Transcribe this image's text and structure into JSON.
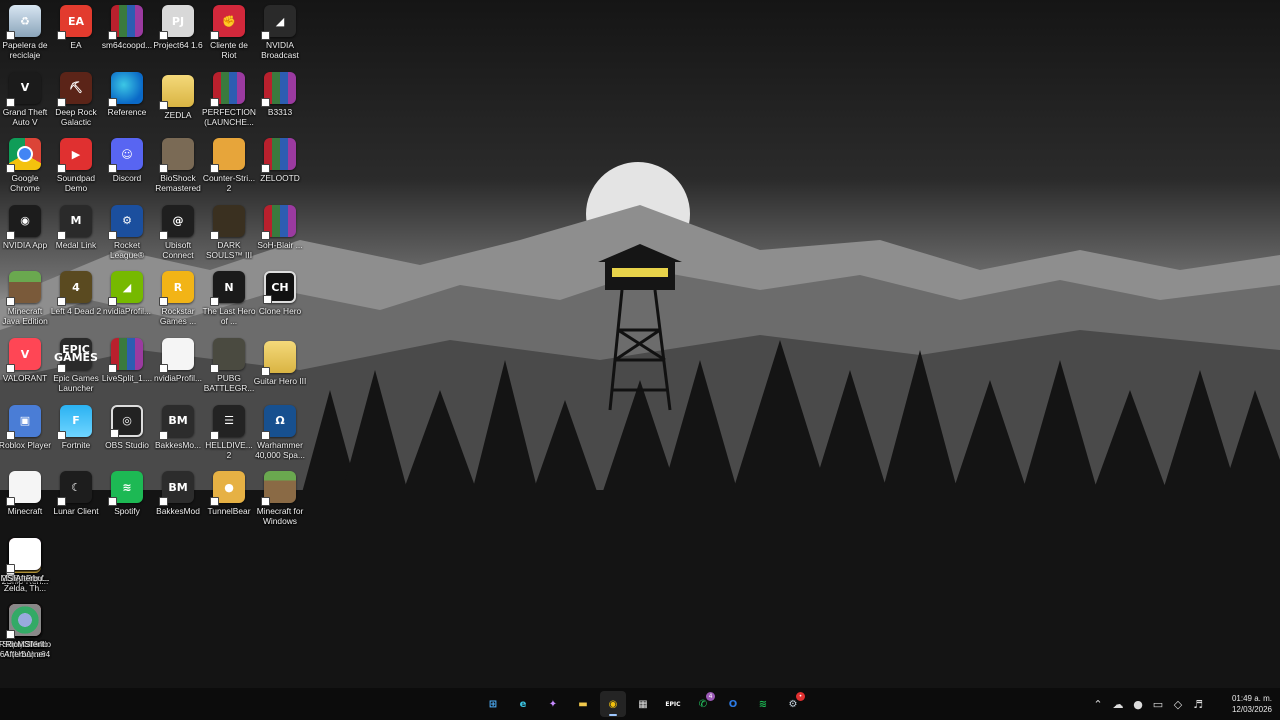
{
  "desktop": {
    "icons": [
      {
        "label": "Papelera de reciclaje",
        "icon": "recycle-bin-icon"
      },
      {
        "label": "EA",
        "icon": "ea-icon"
      },
      {
        "label": "sm64coopd...",
        "icon": "winrar-archive-icon"
      },
      {
        "label": "Project64 1.6",
        "icon": "project64-icon"
      },
      {
        "label": "Cliente de Riot",
        "icon": "riot-client-icon"
      },
      {
        "label": "NVIDIA Broadcast",
        "icon": "nvidia-broadcast-icon"
      },
      {
        "label": "Grand Theft Auto V",
        "icon": "gta-v-icon"
      },
      {
        "label": "Deep Rock Galactic",
        "icon": "deep-rock-galactic-icon"
      },
      {
        "label": "Reference",
        "icon": "edge-icon"
      },
      {
        "label": "ZEDLA",
        "icon": "folder-icon"
      },
      {
        "label": "PERFECTION (LAUNCHE...",
        "icon": "winrar-archive-icon"
      },
      {
        "label": "B3313",
        "icon": "winrar-archive-icon"
      },
      {
        "label": "Google Chrome",
        "icon": "chrome-icon"
      },
      {
        "label": "Soundpad Demo",
        "icon": "soundpad-icon"
      },
      {
        "label": "Discord",
        "icon": "discord-icon"
      },
      {
        "label": "BioShock Remastered",
        "icon": "bioshock-icon"
      },
      {
        "label": "Counter-Stri... 2",
        "icon": "counter-strike-icon"
      },
      {
        "label": "ZELOOTD",
        "icon": "winrar-archive-icon"
      },
      {
        "label": "NVIDIA App",
        "icon": "nvidia-app-icon"
      },
      {
        "label": "Medal Link",
        "icon": "medal-link-icon"
      },
      {
        "label": "Rocket League®",
        "icon": "rocket-league-icon"
      },
      {
        "label": "Ubisoft Connect",
        "icon": "ubisoft-connect-icon"
      },
      {
        "label": "DARK SOULS™ III",
        "icon": "dark-souls-icon"
      },
      {
        "label": "SoH-Blair ...",
        "icon": "winrar-archive-icon"
      },
      {
        "label": "Minecraft Java Edition",
        "icon": "minecraft-icon"
      },
      {
        "label": "Left 4 Dead 2",
        "icon": "left4dead-icon"
      },
      {
        "label": "nvidiaProfil...",
        "icon": "nvidia-profile-icon"
      },
      {
        "label": "Rockstar Games ...",
        "icon": "rockstar-icon"
      },
      {
        "label": "The Last Hero of ...",
        "icon": "last-hero-icon"
      },
      {
        "label": "Clone Hero",
        "icon": "clone-hero-icon"
      },
      {
        "label": "VALORANT",
        "icon": "valorant-icon"
      },
      {
        "label": "Epic Games Launcher",
        "icon": "epic-games-icon"
      },
      {
        "label": "LiveSplit_1....",
        "icon": "winrar-archive-icon"
      },
      {
        "label": "nvidiaProfil...",
        "icon": "file-icon"
      },
      {
        "label": "PUBG BATTLEGR...",
        "icon": "pubg-icon"
      },
      {
        "label": "Guitar Hero III",
        "icon": "folder-icon"
      },
      {
        "label": "Roblox Player",
        "icon": "roblox-icon"
      },
      {
        "label": "Fortnite",
        "icon": "fortnite-icon"
      },
      {
        "label": "OBS Studio",
        "icon": "obs-icon"
      },
      {
        "label": "BakkesMo...",
        "icon": "bakkesmod-icon"
      },
      {
        "label": "HELLDIVE... 2",
        "icon": "helldivers-icon"
      },
      {
        "label": "Warhammer 40,000 Spa...",
        "icon": "warhammer-icon"
      },
      {
        "label": "Minecraft",
        "icon": "file-icon"
      },
      {
        "label": "Lunar Client",
        "icon": "lunar-client-icon"
      },
      {
        "label": "Spotify",
        "icon": "spotify-icon"
      },
      {
        "label": "BakkesMod",
        "icon": "bakkesmod-icon"
      },
      {
        "label": "TunnelBear",
        "icon": "tunnelbear-icon"
      },
      {
        "label": "Minecraft for Windows",
        "icon": "minecraft-windows-icon"
      },
      {
        "label": "2Ship-Ren...",
        "icon": "folder-icon"
      },
      {
        "label": "Steam",
        "icon": "steam-icon"
      },
      {
        "label": "Legend of Zelda, Th...",
        "icon": "file-icon"
      },
      {
        "label": "2Ship-Ren...",
        "icon": "winrar-archive-icon"
      },
      {
        "label": "MSIAfterbu...",
        "icon": "msi-afterburner-file-icon"
      },
      {
        "label": "Roblox Studio",
        "icon": "roblox-studio-icon"
      },
      {
        "label": "Project64",
        "icon": "project64-icon"
      },
      {
        "label": "Super Mario 64 (USA).z64",
        "icon": "file-icon"
      },
      {
        "label": "Riot Client",
        "icon": "riot-client-icon"
      },
      {
        "label": "MSI Afterburner",
        "icon": "msi-afterburner-icon"
      }
    ]
  },
  "taskbar": {
    "apps": [
      {
        "name": "start-button",
        "icon": "windows-logo-icon"
      },
      {
        "name": "taskbar-edge",
        "icon": "edge-icon"
      },
      {
        "name": "taskbar-copilot",
        "icon": "copilot-icon"
      },
      {
        "name": "taskbar-file-explorer",
        "icon": "folder-icon"
      },
      {
        "name": "taskbar-chrome",
        "icon": "chrome-icon",
        "active": true
      },
      {
        "name": "taskbar-store",
        "icon": "store-icon"
      },
      {
        "name": "taskbar-epic",
        "icon": "epic-games-icon"
      },
      {
        "name": "taskbar-whatsapp",
        "icon": "whatsapp-icon",
        "badge": "4"
      },
      {
        "name": "taskbar-outlook",
        "icon": "outlook-icon"
      },
      {
        "name": "taskbar-spotify",
        "icon": "spotify-icon"
      },
      {
        "name": "taskbar-steam",
        "icon": "steam-icon",
        "badge": "•"
      }
    ],
    "tray": {
      "icons": [
        "chevron-up-icon",
        "onedrive-icon",
        "microphone-icon",
        "monitor-icon",
        "network-icon",
        "volume-icon"
      ],
      "time": "01:49 a. m.",
      "date": "12/03/2026"
    }
  },
  "colors": {
    "sky_top": "#1a1a1a",
    "sky_mid": "#3a3a3a",
    "horizon": "#9a9a9a",
    "tower_window": "#e8d34a",
    "ground": "#0b0b0b"
  }
}
